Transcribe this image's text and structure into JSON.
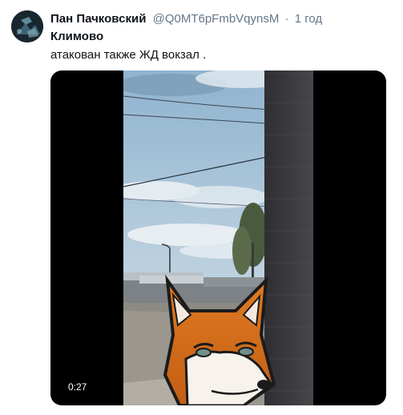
{
  "tweet": {
    "author_name": "Пан Пачковский",
    "author_handle": "@Q0MT6pFmbVqynsM",
    "separator": "·",
    "timestamp": "1 год",
    "title": "Климово",
    "text": "атакован также ЖД вокзал ."
  },
  "media": {
    "type": "video",
    "duration": "0:27",
    "overlay_icon": "fox-face-icon"
  },
  "colors": {
    "text": "#0f1419",
    "secondary": "#657786",
    "media_background": "#000000"
  }
}
